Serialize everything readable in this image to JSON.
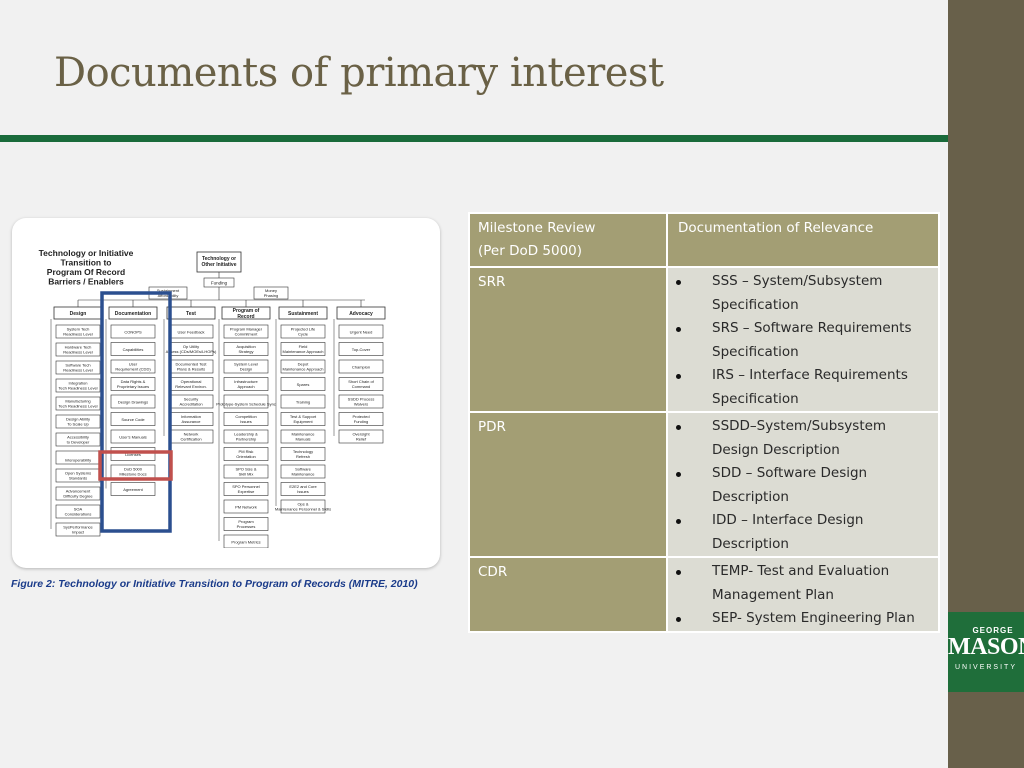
{
  "slide": {
    "title": "Documents of primary interest",
    "figure_caption": "Figure 2:  Technology or Initiative Transition to Program of Records (MITRE, 2010)"
  },
  "figure": {
    "heading_lines": [
      "Technology or Initiative",
      "Transition to",
      "Program Of Record",
      "Barriers / Enablers"
    ],
    "root_box": [
      "Technology or",
      "Other Initiative"
    ],
    "funding": "Funding",
    "sustainment_affordability": [
      "Sustainment",
      "Affordability"
    ],
    "money_phasing": [
      "Money",
      "Phasing"
    ],
    "columns": [
      {
        "header": "Design",
        "items": [
          "System Tech Readiness Level",
          "Hardware Tech Readiness Level",
          "Software Tech Readiness Level",
          "Integration Tech Readiness Level",
          "Manufacturing Tech Readiness Level",
          "Design Ability To Scale Up",
          "Accessibility to Developer",
          "Interoperability",
          "Open Systems Standards",
          "Advancement Difficulty Degree",
          "SOA Considerations",
          "SysPerformance Impact"
        ]
      },
      {
        "header": "Documentation",
        "items": [
          "CONOPS",
          "Capabilities",
          "User Requirement (CDD)",
          "Data Rights & Proprietary Issues",
          "Design Drawings",
          "Source Code",
          "User's Manuals",
          "Licenses",
          "DoD 5000 Milestone Docs",
          "Agreement"
        ]
      },
      {
        "header": "Test",
        "items": [
          "User Feedback",
          "Op Utility Assess (CDs/MOEs/LHOPs)",
          "Documented Test Plans & Results",
          "Operational Relevant Environ.",
          "Security Accreditation",
          "Information Assurance",
          "Network Certification"
        ]
      },
      {
        "header": "Program of Record",
        "items": [
          "Program Manager Commitment",
          "Acquisition Strategy",
          "System Level Design",
          "Infrastructure Approach",
          "Prototype-System Schedule Sync",
          "Competition Issues",
          "Leadership & Partnership",
          "PM Risk Orientation",
          "SPO Size & Skill Mix",
          "SPO Personnel Expertise",
          "PM Network",
          "Program Processes",
          "Program Metrics"
        ]
      },
      {
        "header": "Sustainment",
        "items": [
          "Projected Life Cycle",
          "Field Maintenance Approach",
          "Depot Maintenance Approach",
          "Spares",
          "Training",
          "Test & Support Equipment",
          "Maintenance Manuals",
          "Technology Refresh",
          "Software Maintenance",
          "E2E2 and Core Issues",
          "Ops & Maintenance Personnel & Skills"
        ]
      },
      {
        "header": "Advocacy",
        "items": [
          "Urgent Need",
          "Top-Cover",
          "Champion",
          "Short Chain of Command",
          "SSDD Process Waivers",
          "Protected Funding",
          "Oversight Relief"
        ]
      }
    ]
  },
  "table": {
    "header": {
      "col1_line1": "Milestone Review",
      "col1_line2": "(Per DoD 5000)",
      "col2": "Documentation of Relevance"
    },
    "rows": [
      {
        "milestone": "SRR",
        "docs": [
          "SSS – System/Subsystem Specification",
          "SRS – Software Requirements Specification",
          "IRS – Interface Requirements Specification"
        ]
      },
      {
        "milestone": "PDR",
        "docs": [
          "SSDD–System/Subsystem Design Description",
          "SDD – Software Design Description",
          "IDD – Interface Design Description"
        ]
      },
      {
        "milestone": "CDR",
        "docs": [
          "TEMP- Test and Evaluation Management Plan",
          "SEP- System Engineering Plan"
        ]
      }
    ]
  },
  "logo": {
    "line1": "GEORGE",
    "line2": "MASON",
    "line3": "UNIVERSITY"
  },
  "colors": {
    "title": "#6a6146",
    "rule": "#1a6b3b",
    "sidebar": "#68604a",
    "table_header": "#a39e74",
    "table_cell": "#dcdcd3",
    "logo_bg": "#1f6e3a",
    "highlight_blue": "#2b4f8f",
    "highlight_red": "#c0504d"
  }
}
